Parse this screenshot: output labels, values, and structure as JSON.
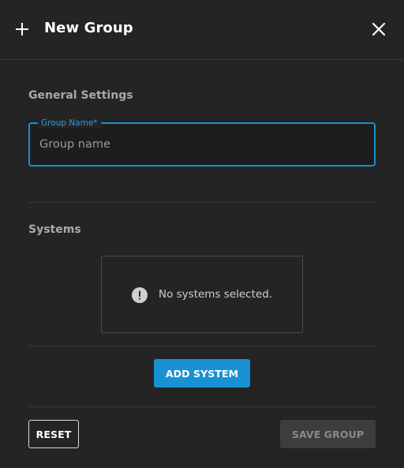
{
  "header": {
    "title": "New Group",
    "icon_left": "plus-icon",
    "icon_right": "close-icon"
  },
  "general_settings": {
    "heading": "General Settings",
    "group_name_field": {
      "label": "Group Name*",
      "placeholder": "Group name",
      "value": ""
    }
  },
  "systems": {
    "heading": "Systems",
    "empty_message": "No systems selected.",
    "empty_icon": "info-icon",
    "add_button_label": "ADD SYSTEM"
  },
  "footer": {
    "reset_label": "RESET",
    "save_label": "SAVE GROUP"
  },
  "colors": {
    "background": "#242424",
    "accent": "#1992d4",
    "disabled_button": "#3d3d3d"
  }
}
